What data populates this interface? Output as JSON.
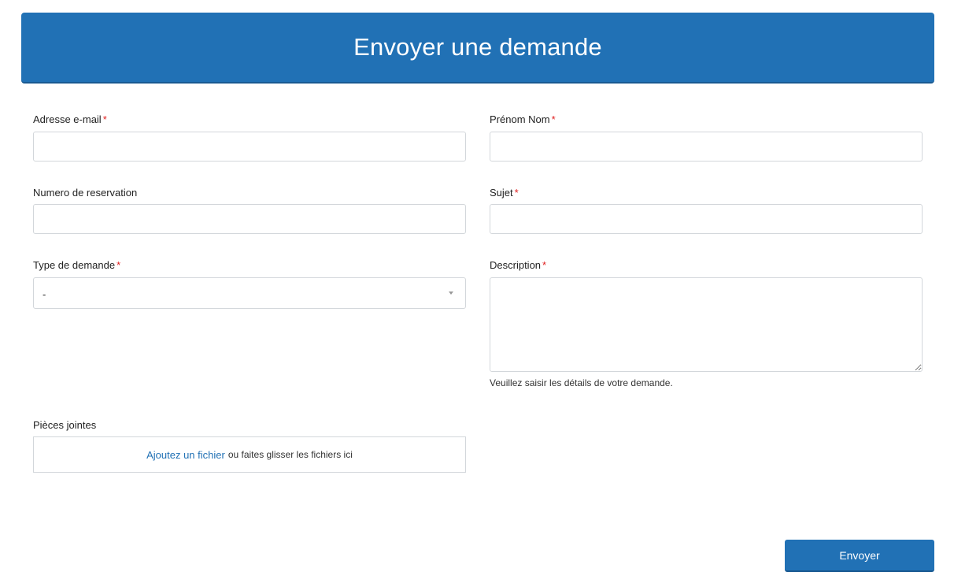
{
  "header": {
    "title": "Envoyer une demande"
  },
  "required_marker": "*",
  "fields": {
    "email": {
      "label": "Adresse e-mail",
      "value": ""
    },
    "name": {
      "label": "Prénom Nom",
      "value": ""
    },
    "reservation": {
      "label": "Numero de reservation",
      "value": ""
    },
    "subject": {
      "label": "Sujet",
      "value": ""
    },
    "request_type": {
      "label": "Type de demande",
      "selected": "-"
    },
    "description": {
      "label": "Description",
      "value": "",
      "hint": "Veuillez saisir les détails de votre demande."
    },
    "attachments": {
      "label": "Pièces jointes",
      "link": "Ajoutez un fichier",
      "text": "ou faites glisser les fichiers ici"
    }
  },
  "submit": {
    "label": "Envoyer"
  },
  "colors": {
    "accent": "#2171b5",
    "required": "#e02020",
    "border": "#d3d7db"
  }
}
